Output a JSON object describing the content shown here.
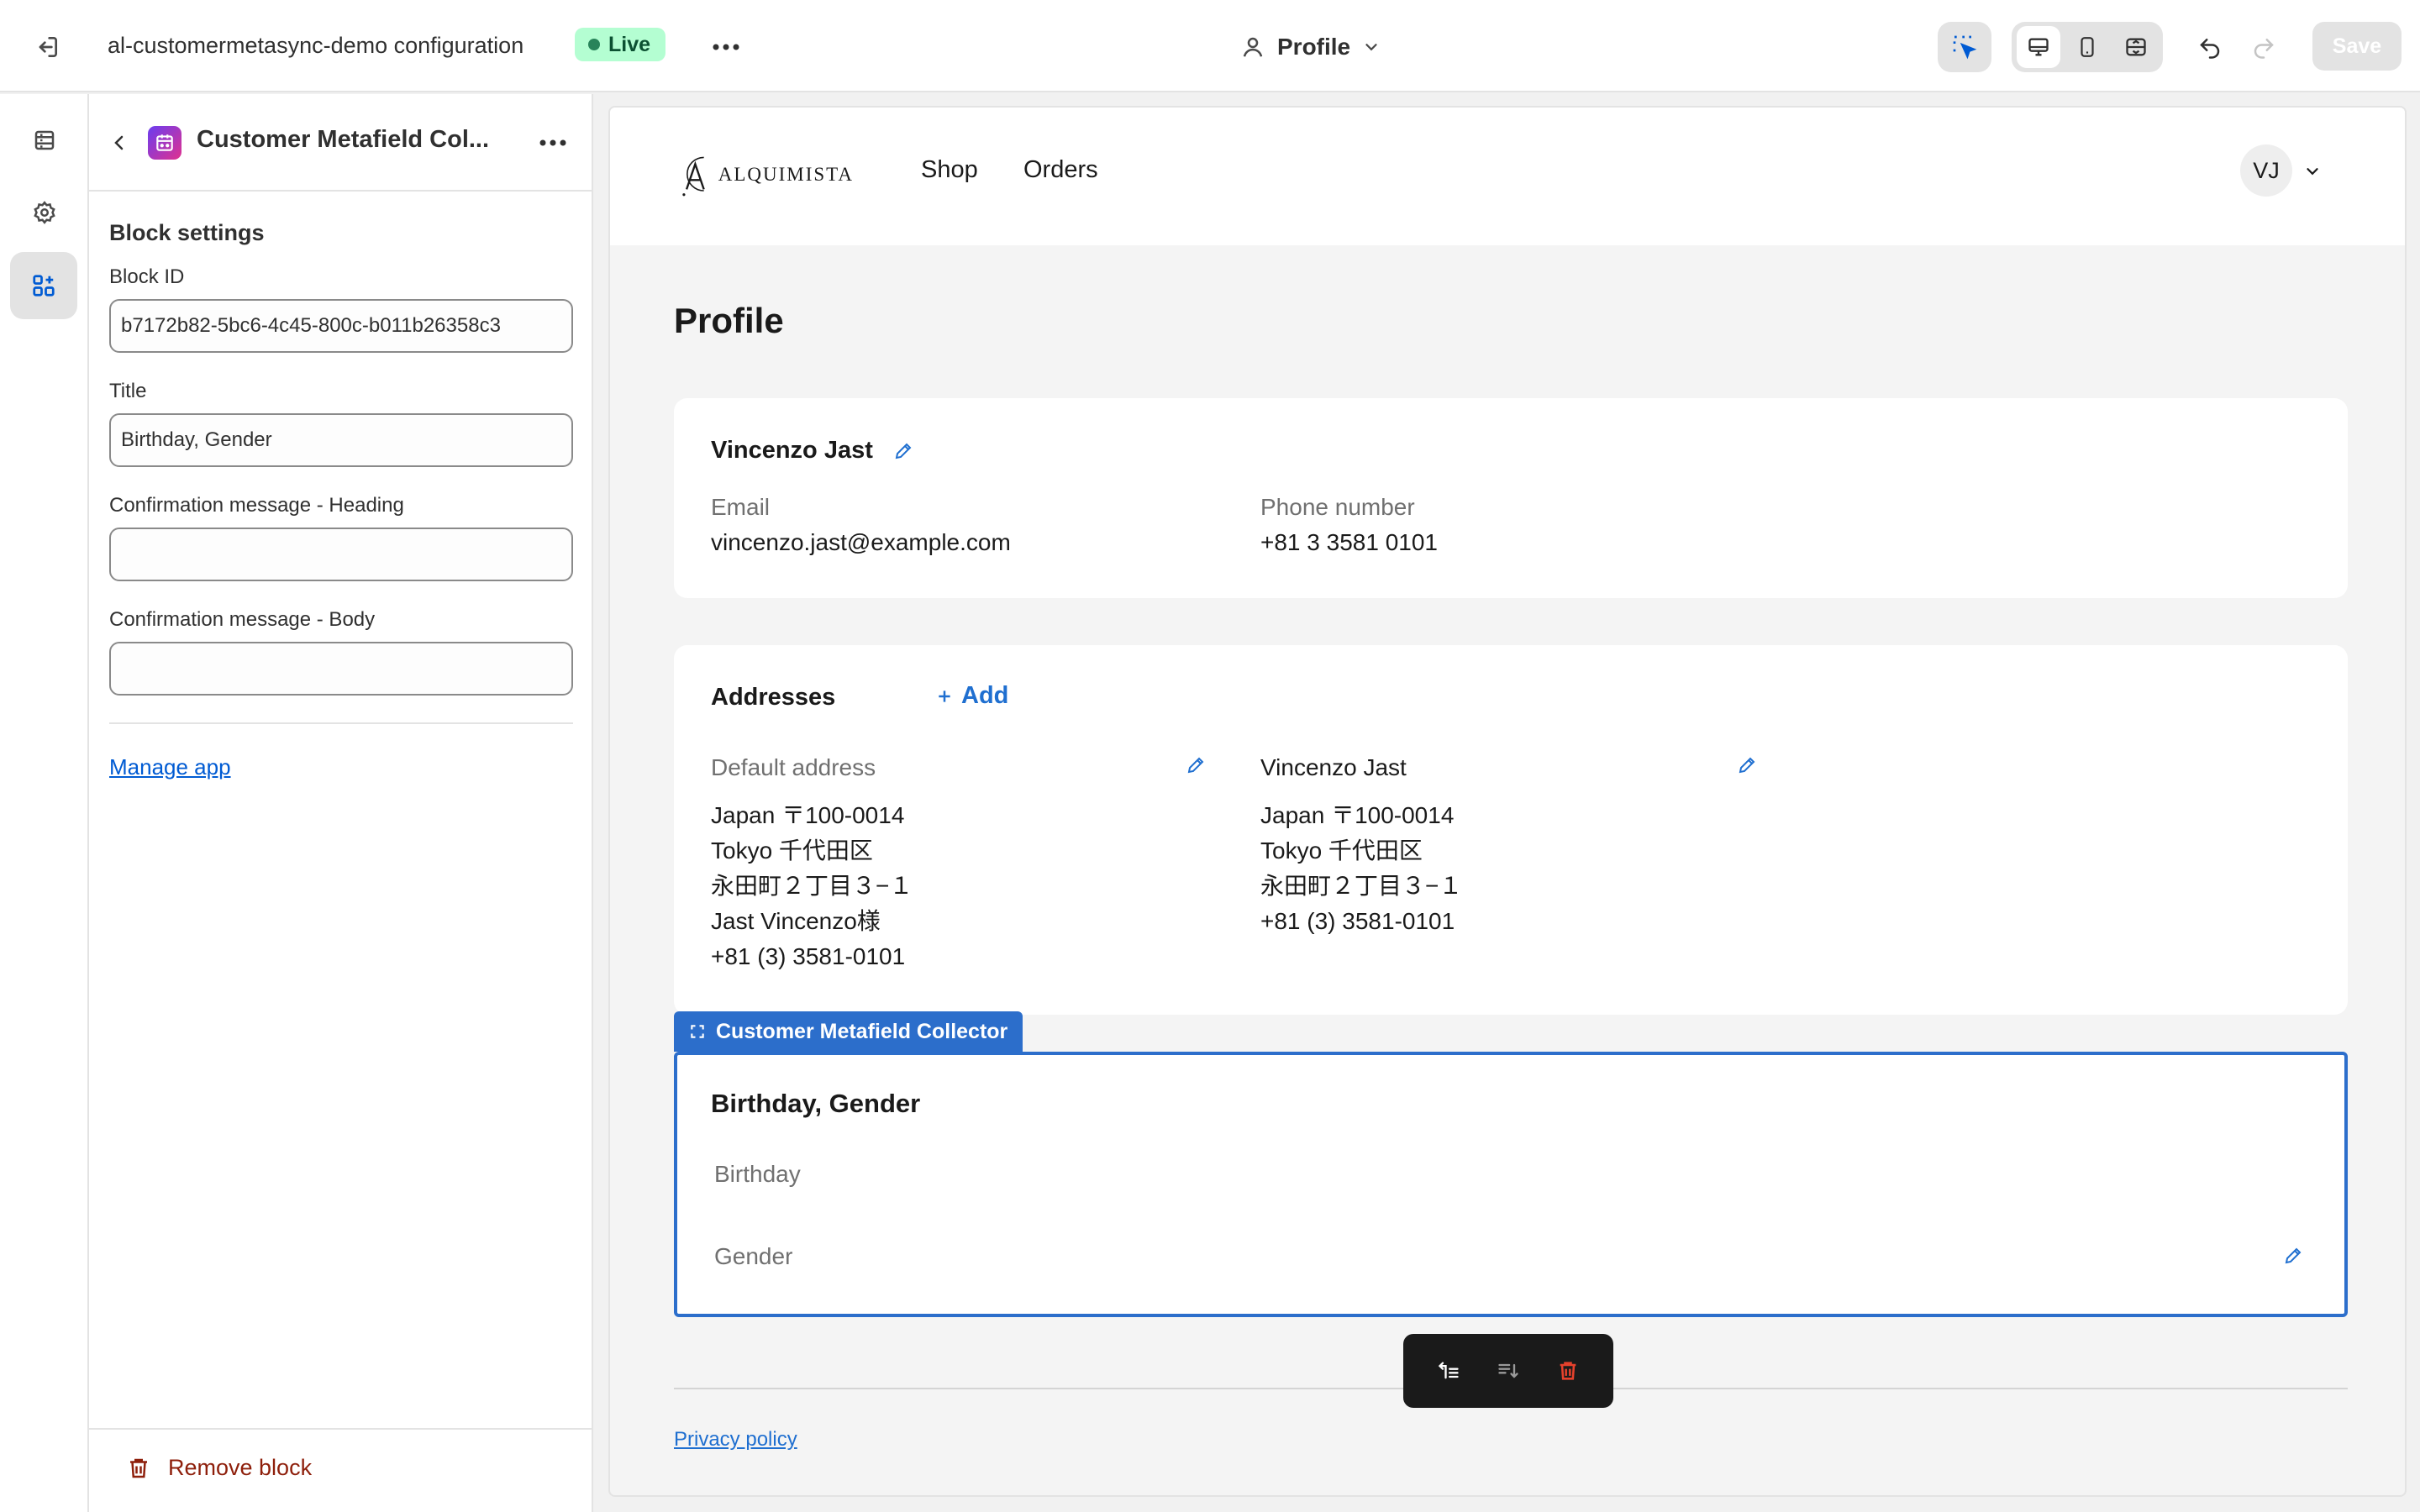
{
  "topbar": {
    "title": "al-customermetasync-demo configuration",
    "status_badge": "Live",
    "template_select": "Profile",
    "save_label": "Save"
  },
  "panel": {
    "title": "Customer Metafield Col...",
    "section_heading": "Block settings",
    "fields": {
      "block_id_label": "Block ID",
      "block_id_value": "b7172b82-5bc6-4c45-800c-b011b26358c3",
      "title_label": "Title",
      "title_value": "Birthday, Gender",
      "confirm_heading_label": "Confirmation message - Heading",
      "confirm_heading_value": "",
      "confirm_body_label": "Confirmation message - Body",
      "confirm_body_value": ""
    },
    "manage_app": "Manage app",
    "remove_block": "Remove block"
  },
  "store": {
    "brand": "ALQUIMISTA",
    "nav": [
      "Shop",
      "Orders"
    ],
    "avatar_initials": "VJ"
  },
  "profile": {
    "heading": "Profile",
    "customer_name": "Vincenzo Jast",
    "email_label": "Email",
    "email": "vincenzo.jast@example.com",
    "phone_label": "Phone number",
    "phone": "+81 3 3581 0101"
  },
  "addresses": {
    "heading": "Addresses",
    "add_label": "Add",
    "default_label": "Default address",
    "default_lines": [
      "Japan 〒100-0014",
      "Tokyo 千代田区",
      "永田町２丁目３−１",
      "Jast Vincenzo様",
      "+81 (3) 3581-0101"
    ],
    "second_name": "Vincenzo Jast",
    "second_lines": [
      "Japan 〒100-0014",
      "Tokyo 千代田区",
      "永田町２丁目３−１",
      "+81 (3) 3581-0101"
    ]
  },
  "metafield_block": {
    "tag_label": "Customer Metafield Collector",
    "title": "Birthday, Gender",
    "fields": [
      "Birthday",
      "Gender"
    ]
  },
  "footer": {
    "privacy": "Privacy policy"
  },
  "colors": {
    "accent": "#2c6ecb",
    "live_badge_bg": "#b4fed2",
    "danger": "#8e1f0b",
    "link": "#005bd3"
  }
}
